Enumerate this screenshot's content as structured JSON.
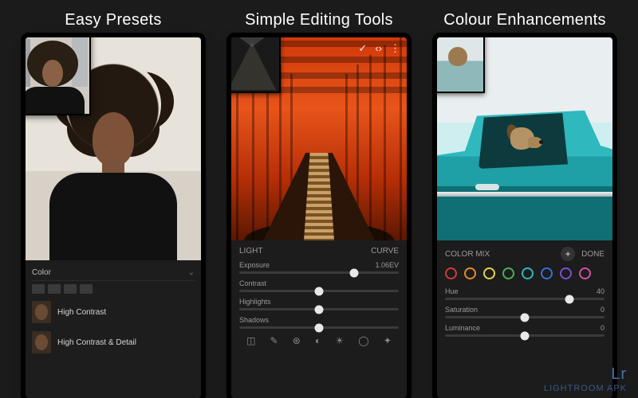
{
  "columns": [
    {
      "heading": "Easy Presets"
    },
    {
      "heading": "Simple Editing Tools"
    },
    {
      "heading": "Colour Enhancements"
    }
  ],
  "presets_panel": {
    "dropdown_label": "Color",
    "items": [
      {
        "name": "High Contrast"
      },
      {
        "name": "High Contrast & Detail"
      }
    ]
  },
  "light_panel": {
    "tab": "LIGHT",
    "mode": "CURVE",
    "sliders": [
      {
        "name": "Exposure",
        "value": "1.06EV",
        "pos": 72
      },
      {
        "name": "Contrast",
        "value": "",
        "pos": 50
      },
      {
        "name": "Highlights",
        "value": "",
        "pos": 50
      },
      {
        "name": "Shadows",
        "value": "",
        "pos": 50
      }
    ],
    "tool_icons": [
      "crop-icon",
      "brush-icon",
      "heal-icon",
      "filter-icon",
      "light-icon",
      "color-icon",
      "effects-icon"
    ]
  },
  "color_panel": {
    "tab": "COLOR MIX",
    "done": "DONE",
    "swatches": [
      "#d23a3a",
      "#e68a2e",
      "#e6d34a",
      "#4caf50",
      "#2fb8bd",
      "#3a6fd2",
      "#7b4fd2",
      "#d24fa8"
    ],
    "sliders": [
      {
        "name": "Hue",
        "value": "40",
        "pos": 78
      },
      {
        "name": "Saturation",
        "value": "0",
        "pos": 50
      },
      {
        "name": "Luminance",
        "value": "0",
        "pos": 50
      }
    ]
  },
  "top_icons": {
    "check": "✓",
    "share": "‹›",
    "more": "⋮"
  },
  "watermark": {
    "logo": "Lr",
    "text": "LIGHTROOM APK"
  }
}
